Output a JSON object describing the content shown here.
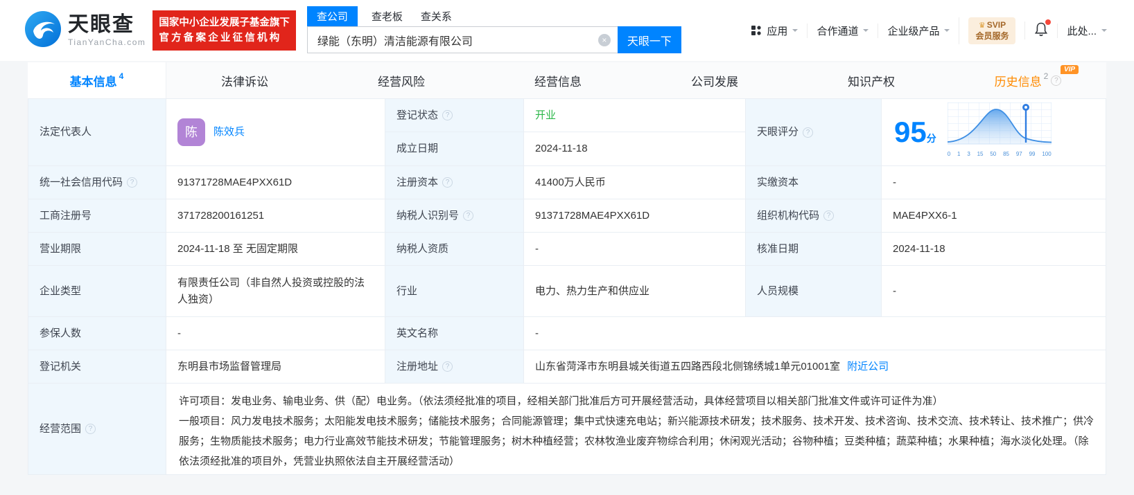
{
  "icons": {
    "help_glyph": "?",
    "clear_glyph": "×",
    "crown_glyph": "♛"
  },
  "colors": {
    "accent_blue": "#0084ff",
    "status_green": "#2ab648",
    "history_orange": "#ff8a00",
    "badge_red": "#e1251b",
    "avatar_purple": "#b284d6"
  },
  "header": {
    "brand": "天眼查",
    "brand_domain": "TianYanCha.com",
    "cert_badge_line1": "国家中小企业发展子基金旗下",
    "cert_badge_line2": "官方备案企业征信机构",
    "search_tabs": [
      {
        "label": "查公司"
      },
      {
        "label": "查老板"
      },
      {
        "label": "查关系"
      }
    ],
    "search_value": "绿能（东明）清洁能源有限公司",
    "search_button": "天眼一下",
    "nav_apps": "应用",
    "nav_partner": "合作通道",
    "nav_enterprise": "企业级产品",
    "vip_line1": "SVIP",
    "vip_line2": "会员服务",
    "user_name": "此处..."
  },
  "tabs": [
    {
      "label": "基本信息",
      "count": "4"
    },
    {
      "label": "法律诉讼"
    },
    {
      "label": "经营风险"
    },
    {
      "label": "经营信息"
    },
    {
      "label": "公司发展"
    },
    {
      "label": "知识产权"
    },
    {
      "label": "历史信息",
      "count": "2",
      "vip_badge": "VIP"
    }
  ],
  "table": {
    "legal_rep": {
      "label": "法定代表人",
      "avatar_text": "陈",
      "name": "陈效兵"
    },
    "reg_status": {
      "label": "登记状态",
      "value": "开业"
    },
    "establish_date": {
      "label": "成立日期",
      "value": "2024-11-18"
    },
    "score": {
      "label": "天眼评分",
      "value": "95",
      "unit": "分",
      "axis": [
        "0",
        "1",
        "3",
        "15",
        "50",
        "85",
        "97",
        "99",
        "100"
      ]
    },
    "credit_code": {
      "label": "统一社会信用代码",
      "value": "91371728MAE4PXX61D"
    },
    "reg_capital": {
      "label": "注册资本",
      "value": "41400万人民币"
    },
    "paid_capital": {
      "label": "实缴资本",
      "value": "-"
    },
    "reg_number": {
      "label": "工商注册号",
      "value": "371728200161251"
    },
    "taxpayer_id": {
      "label": "纳税人识别号",
      "value": "91371728MAE4PXX61D"
    },
    "org_code": {
      "label": "组织机构代码",
      "value": "MAE4PXX6-1"
    },
    "business_term": {
      "label": "营业期限",
      "value": "2024-11-18 至 无固定期限"
    },
    "taxpayer_quality": {
      "label": "纳税人资质",
      "value": "-"
    },
    "approval_date": {
      "label": "核准日期",
      "value": "2024-11-18"
    },
    "company_type": {
      "label": "企业类型",
      "value": "有限责任公司（非自然人投资或控股的法人独资）"
    },
    "industry": {
      "label": "行业",
      "value": "电力、热力生产和供应业"
    },
    "staff_size": {
      "label": "人员规模",
      "value": "-"
    },
    "insured_count": {
      "label": "参保人数",
      "value": "-"
    },
    "english_name": {
      "label": "英文名称",
      "value": "-"
    },
    "reg_authority": {
      "label": "登记机关",
      "value": "东明县市场监督管理局"
    },
    "reg_address": {
      "label": "注册地址",
      "value": "山东省菏泽市东明县城关街道五四路西段北侧锦绣城1单元01001室",
      "nearby_link": "附近公司"
    },
    "business_scope": {
      "label": "经营范围",
      "licensed": "许可项目：发电业务、输电业务、供（配）电业务。（依法须经批准的项目，经相关部门批准后方可开展经营活动，具体经营项目以相关部门批准文件或许可证件为准）",
      "general": "一般项目：风力发电技术服务；太阳能发电技术服务；储能技术服务；合同能源管理；集中式快速充电站；新兴能源技术研发；技术服务、技术开发、技术咨询、技术交流、技术转让、技术推广；供冷服务；生物质能技术服务；电力行业高效节能技术研发；节能管理服务；树木种植经营；农林牧渔业废弃物综合利用；休闲观光活动；谷物种植；豆类种植；蔬菜种植；水果种植；海水淡化处理。（除依法须经批准的项目外，凭营业执照依法自主开展经营活动）"
    }
  }
}
